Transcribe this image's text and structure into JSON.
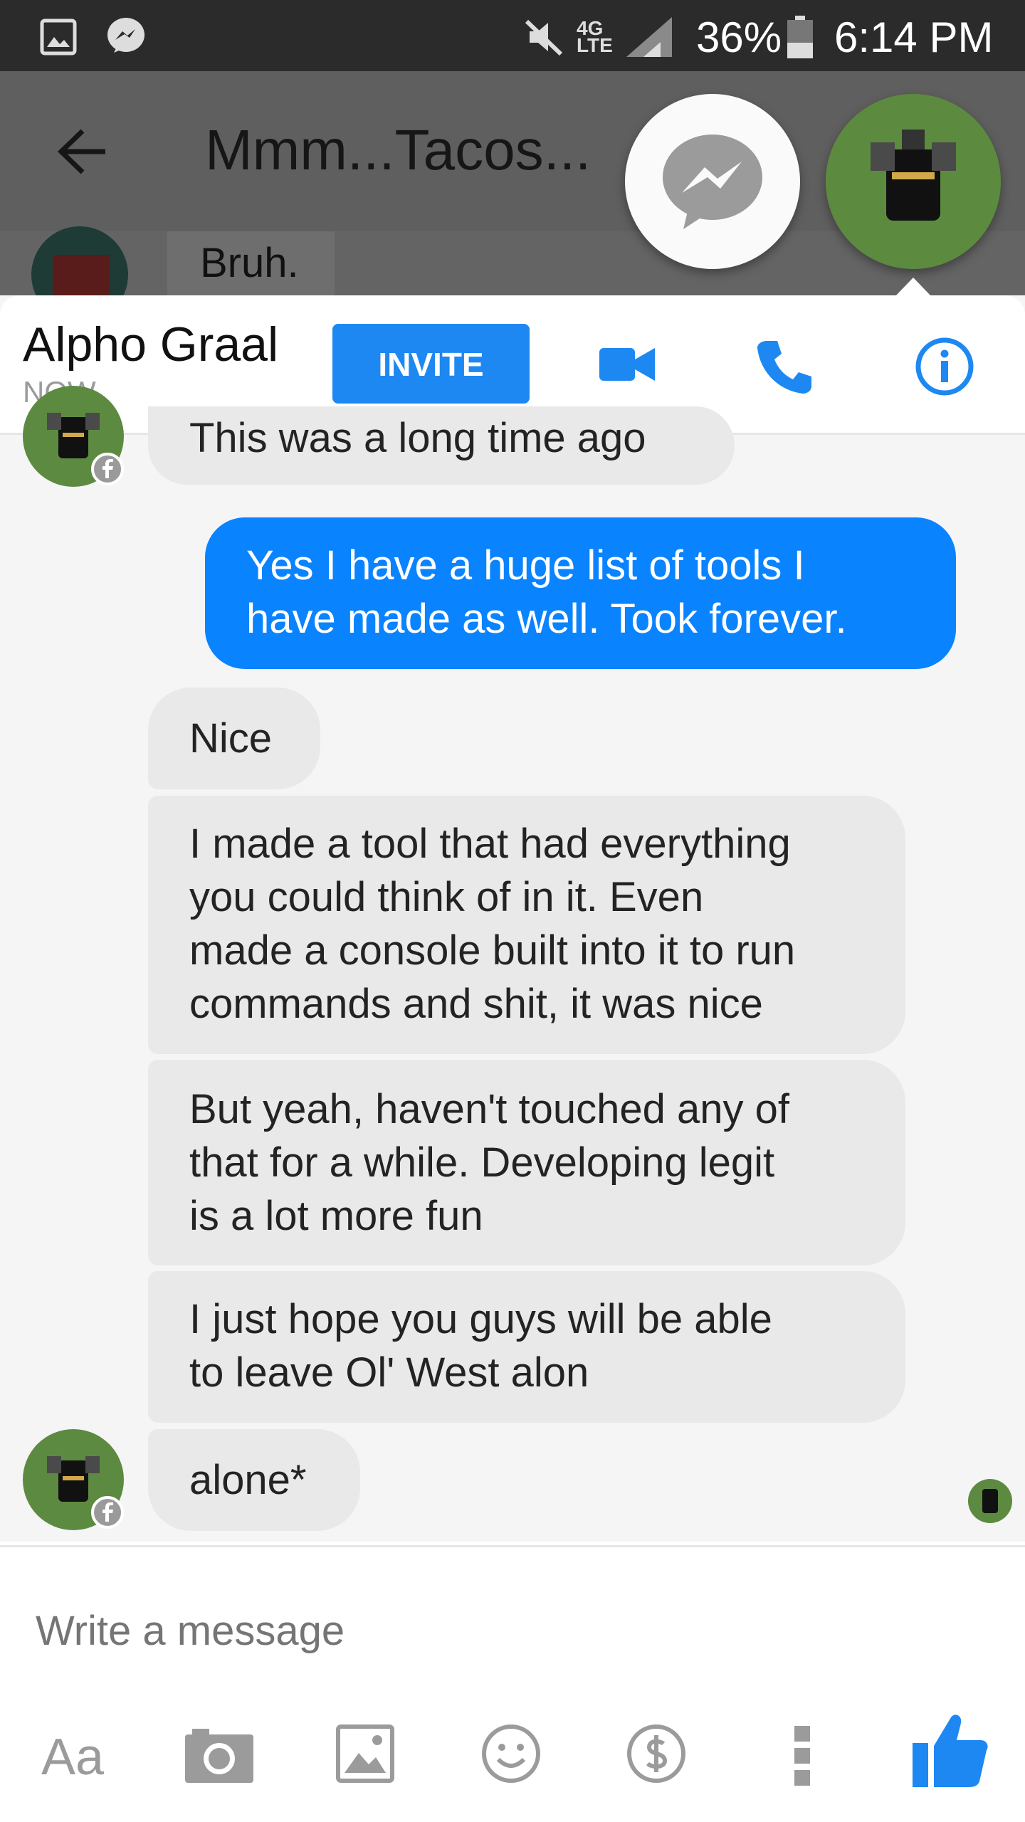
{
  "status_bar": {
    "battery": "36%",
    "time": "6:14 PM",
    "network": "4G LTE",
    "icons": [
      "gallery-icon",
      "messenger-icon",
      "mute-icon",
      "signal-icon",
      "battery-icon"
    ]
  },
  "background_thread": {
    "title": "Mmm...Tacos...",
    "last_message": "Bruh."
  },
  "chat_head": {
    "name": "Alpho Graal",
    "status": "NOW",
    "invite_label": "INVITE"
  },
  "messages": [
    {
      "from": "them",
      "text": "This was a long time ago"
    },
    {
      "from": "me",
      "lines": [
        "Yes I have a huge list of tools I",
        "have made as well. Took forever."
      ]
    },
    {
      "from": "them",
      "text": "Nice"
    },
    {
      "from": "them",
      "lines": [
        "I made a tool that had everything",
        "you could think of in it. Even",
        "made a console built into it to run",
        "commands and shit, it was nice"
      ]
    },
    {
      "from": "them",
      "lines": [
        "But yeah, haven't touched any of",
        "that for a while. Developing legit",
        "is a lot more fun"
      ]
    },
    {
      "from": "them",
      "lines": [
        "I just hope you guys will be able",
        "to leave Ol' West alon"
      ]
    },
    {
      "from": "them",
      "text": "alone*"
    }
  ],
  "composer": {
    "placeholder": "Write a message",
    "text_button": "Aa"
  },
  "colors": {
    "accent": "#0a83ff",
    "incoming_bubble": "#e9e9e9",
    "avatar_green": "#5d8a41"
  }
}
